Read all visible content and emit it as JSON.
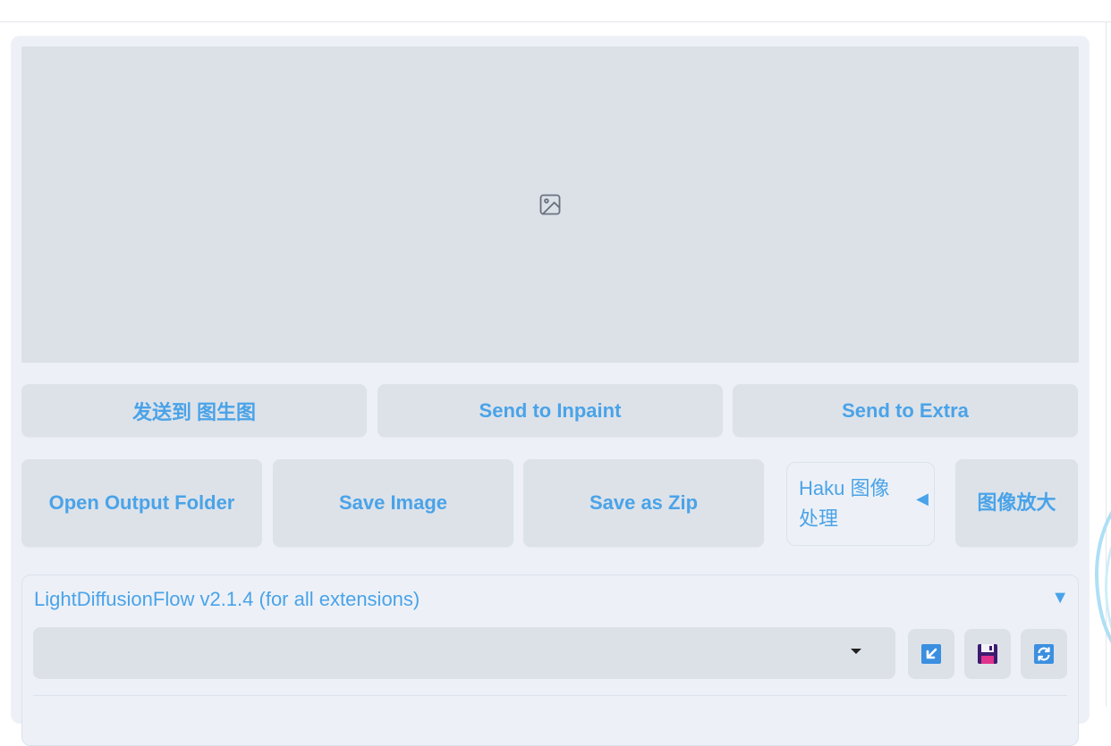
{
  "image_panel": {
    "placeholder_icon": "image-icon"
  },
  "send_row": {
    "to_img2img": "发送到 图生图",
    "to_inpaint": "Send to Inpaint",
    "to_extra": "Send to Extra"
  },
  "action_row": {
    "open_folder": "Open Output Folder",
    "save_image": "Save Image",
    "save_zip": "Save as Zip",
    "haku_label": "Haku 图像处理",
    "haku_arrow": "◀",
    "upscale": "图像放大"
  },
  "lightdiffusionflow": {
    "title": "LightDiffusionFlow v2.1.4 (for all extensions)",
    "toggle": "▼",
    "select_value": "",
    "icons": [
      "import-icon",
      "save-icon",
      "refresh-icon"
    ]
  },
  "colors": {
    "accent": "#4aa3e8",
    "panel_bg": "#edf1f7",
    "button_bg": "#dde2e9"
  }
}
